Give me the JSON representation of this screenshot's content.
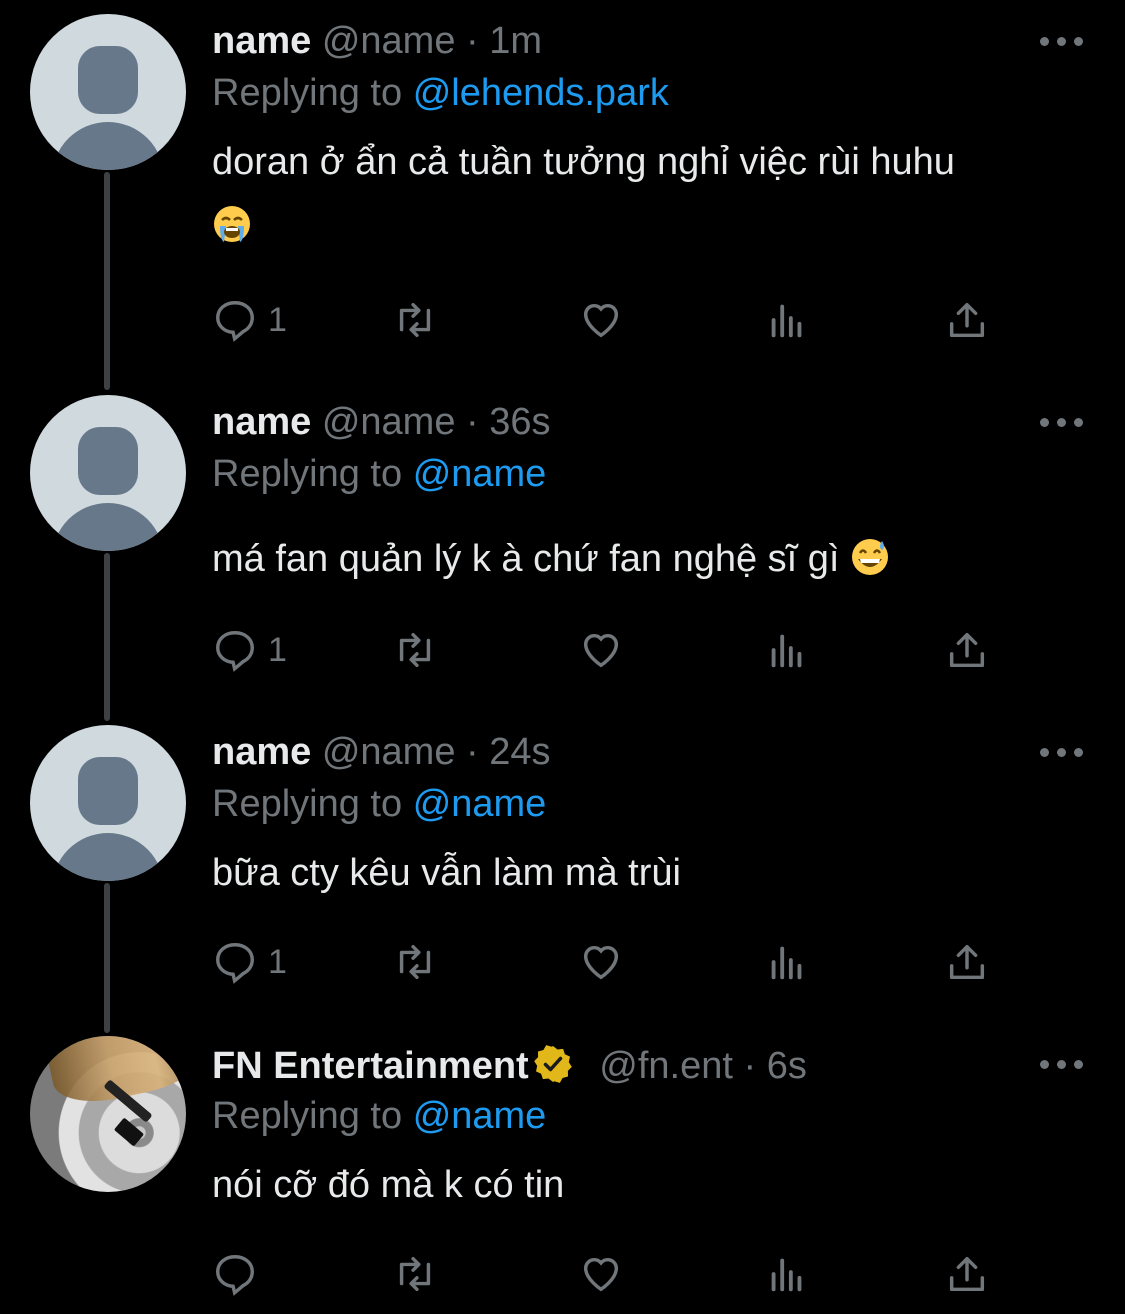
{
  "tweets": [
    {
      "name": "name",
      "handle": "@name",
      "separator": "·",
      "time": "1m",
      "replying_prefix": "Replying to",
      "replying_to": "@lehends.park",
      "text": "doran ở ẩn cả tuần tưởng nghỉ việc rùi huhu",
      "emoji": "loudly-crying-face-emoji",
      "reply_count": "1",
      "avatar": "default-profile-icon"
    },
    {
      "name": "name",
      "handle": "@name",
      "separator": "·",
      "time": "36s",
      "replying_prefix": "Replying to",
      "replying_to": "@name",
      "text": "má fan quản lý k à chứ fan nghệ sĩ gì",
      "emoji": "grinning-face-with-sweat-emoji",
      "reply_count": "1",
      "avatar": "default-profile-icon"
    },
    {
      "name": "name",
      "handle": "@name",
      "separator": "·",
      "time": "24s",
      "replying_prefix": "Replying to",
      "replying_to": "@name",
      "text": "bữa cty kêu vẫn làm mà trùi",
      "reply_count": "1",
      "avatar": "default-profile-icon"
    },
    {
      "name": "FN Entertainment",
      "handle": "@fn.ent",
      "separator": "·",
      "time": "6s",
      "replying_prefix": "Replying to",
      "replying_to": "@name",
      "text": "nói cỡ đó mà k có tin",
      "reply_count": "",
      "avatar": "vinyl-record-avatar",
      "verified": "gold-verified-badge-icon"
    }
  ],
  "icons": {
    "reply": "reply-icon",
    "retweet": "retweet-icon",
    "like": "heart-icon",
    "views": "analytics-icon",
    "share": "share-icon",
    "more": "more-icon"
  },
  "colors": {
    "background": "#000000",
    "primary_text": "#e7e9ea",
    "secondary_text": "#71767b",
    "link": "#1d9bf0",
    "thread_line": "#3e4144",
    "verified_gold": "#e2b719"
  }
}
